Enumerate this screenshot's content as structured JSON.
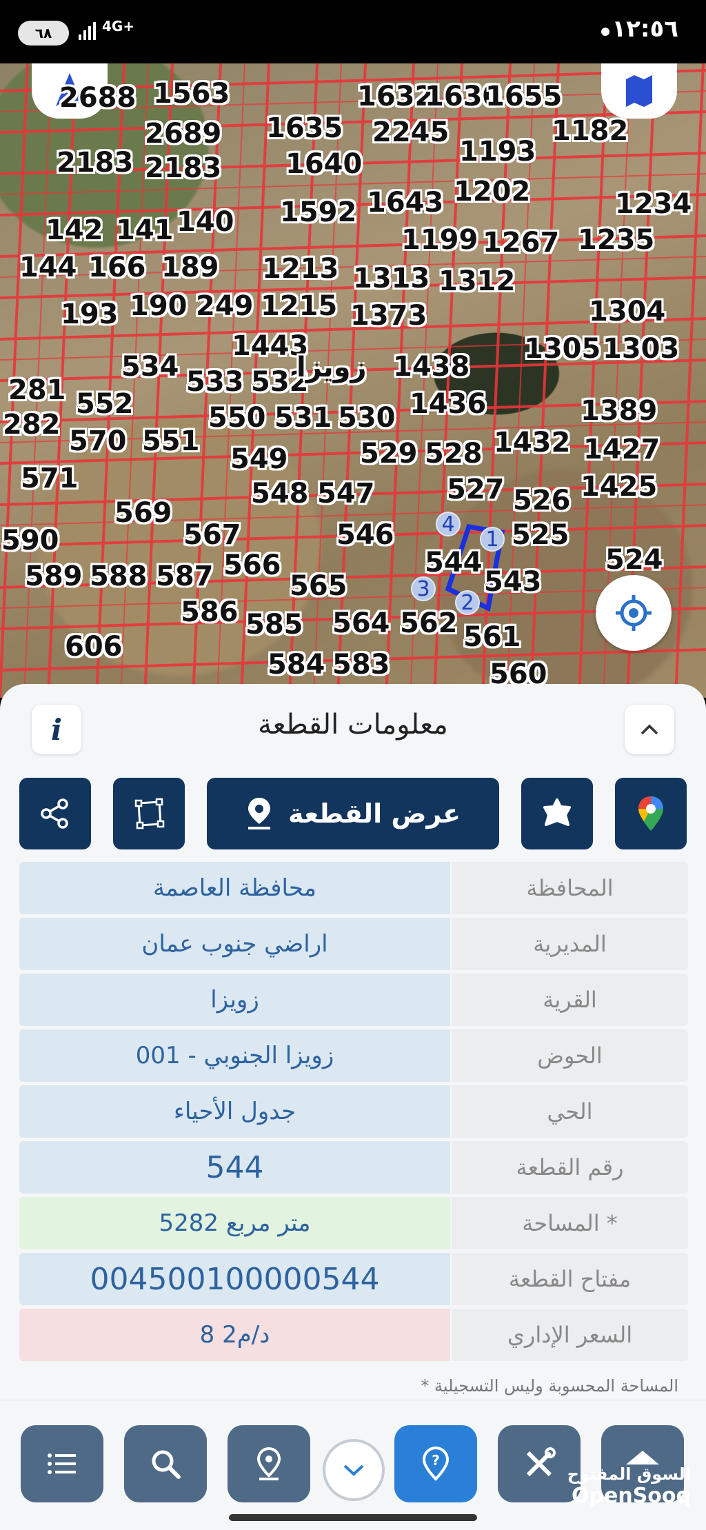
{
  "status_bar": {
    "time": "١٢:٥٦",
    "battery": "٦٨",
    "network": "4G+"
  },
  "map": {
    "village_label": "زويزا",
    "plot_numbers": [
      "1563",
      "2688",
      "1632",
      "1630",
      "1655",
      "2689",
      "1635",
      "2245",
      "1182",
      "2183",
      "2183",
      "1640",
      "1193",
      "1592",
      "1643",
      "1202",
      "1234",
      "142",
      "141",
      "140",
      "1199",
      "1267",
      "1235",
      "144",
      "166",
      "189",
      "1213",
      "1313",
      "1312",
      "193",
      "190",
      "249",
      "1215",
      "1373",
      "1304",
      "1443",
      "1305",
      "1303",
      "534",
      "533",
      "532",
      "1438",
      "281",
      "552",
      "1436",
      "1389",
      "282",
      "550",
      "531",
      "530",
      "570",
      "551",
      "529",
      "528",
      "1432",
      "1427",
      "571",
      "549",
      "548",
      "547",
      "527",
      "526",
      "1425",
      "569",
      "567",
      "546",
      "525",
      "524",
      "590",
      "589",
      "588",
      "587",
      "566",
      "565",
      "544",
      "543",
      "586",
      "585",
      "564",
      "562",
      "561",
      "606",
      "584",
      "583",
      "560"
    ],
    "vertices": [
      "1",
      "2",
      "3",
      "4"
    ]
  },
  "panel": {
    "title": "معلومات القطعة",
    "info_icon": "i",
    "actions": {
      "view_plot_label": "عرض القطعة"
    },
    "rows": [
      {
        "label": "المحافظة",
        "value": "محافظة العاصمة",
        "style": ""
      },
      {
        "label": "المديرية",
        "value": "اراضي جنوب عمان",
        "style": ""
      },
      {
        "label": "القرية",
        "value": "زويزا",
        "style": ""
      },
      {
        "label": "الحوض",
        "value": "زويزا الجنوبي - 001",
        "style": ""
      },
      {
        "label": "الحي",
        "value": "جدول الأحياء",
        "style": ""
      },
      {
        "label": "رقم القطعة",
        "value": "544",
        "style": "big"
      },
      {
        "label": "المساحة *",
        "value": "5282   متر مربع",
        "style": "green"
      },
      {
        "label": "مفتاح القطعة",
        "value": "004500100000544",
        "style": "big"
      },
      {
        "label": "السعر الإداري",
        "value": "8 د/م2",
        "style": "pink"
      }
    ],
    "footnote": "* المساحة المحسوبة وليس التسجيلية"
  },
  "watermark": {
    "arabic": "السوق المفتوح",
    "english": "OpenSooq"
  },
  "colors": {
    "navy": "#12355d",
    "map_lines": "#e8363a",
    "plot_outline": "#1a2fe0",
    "active_nav": "#2a7fd6"
  }
}
